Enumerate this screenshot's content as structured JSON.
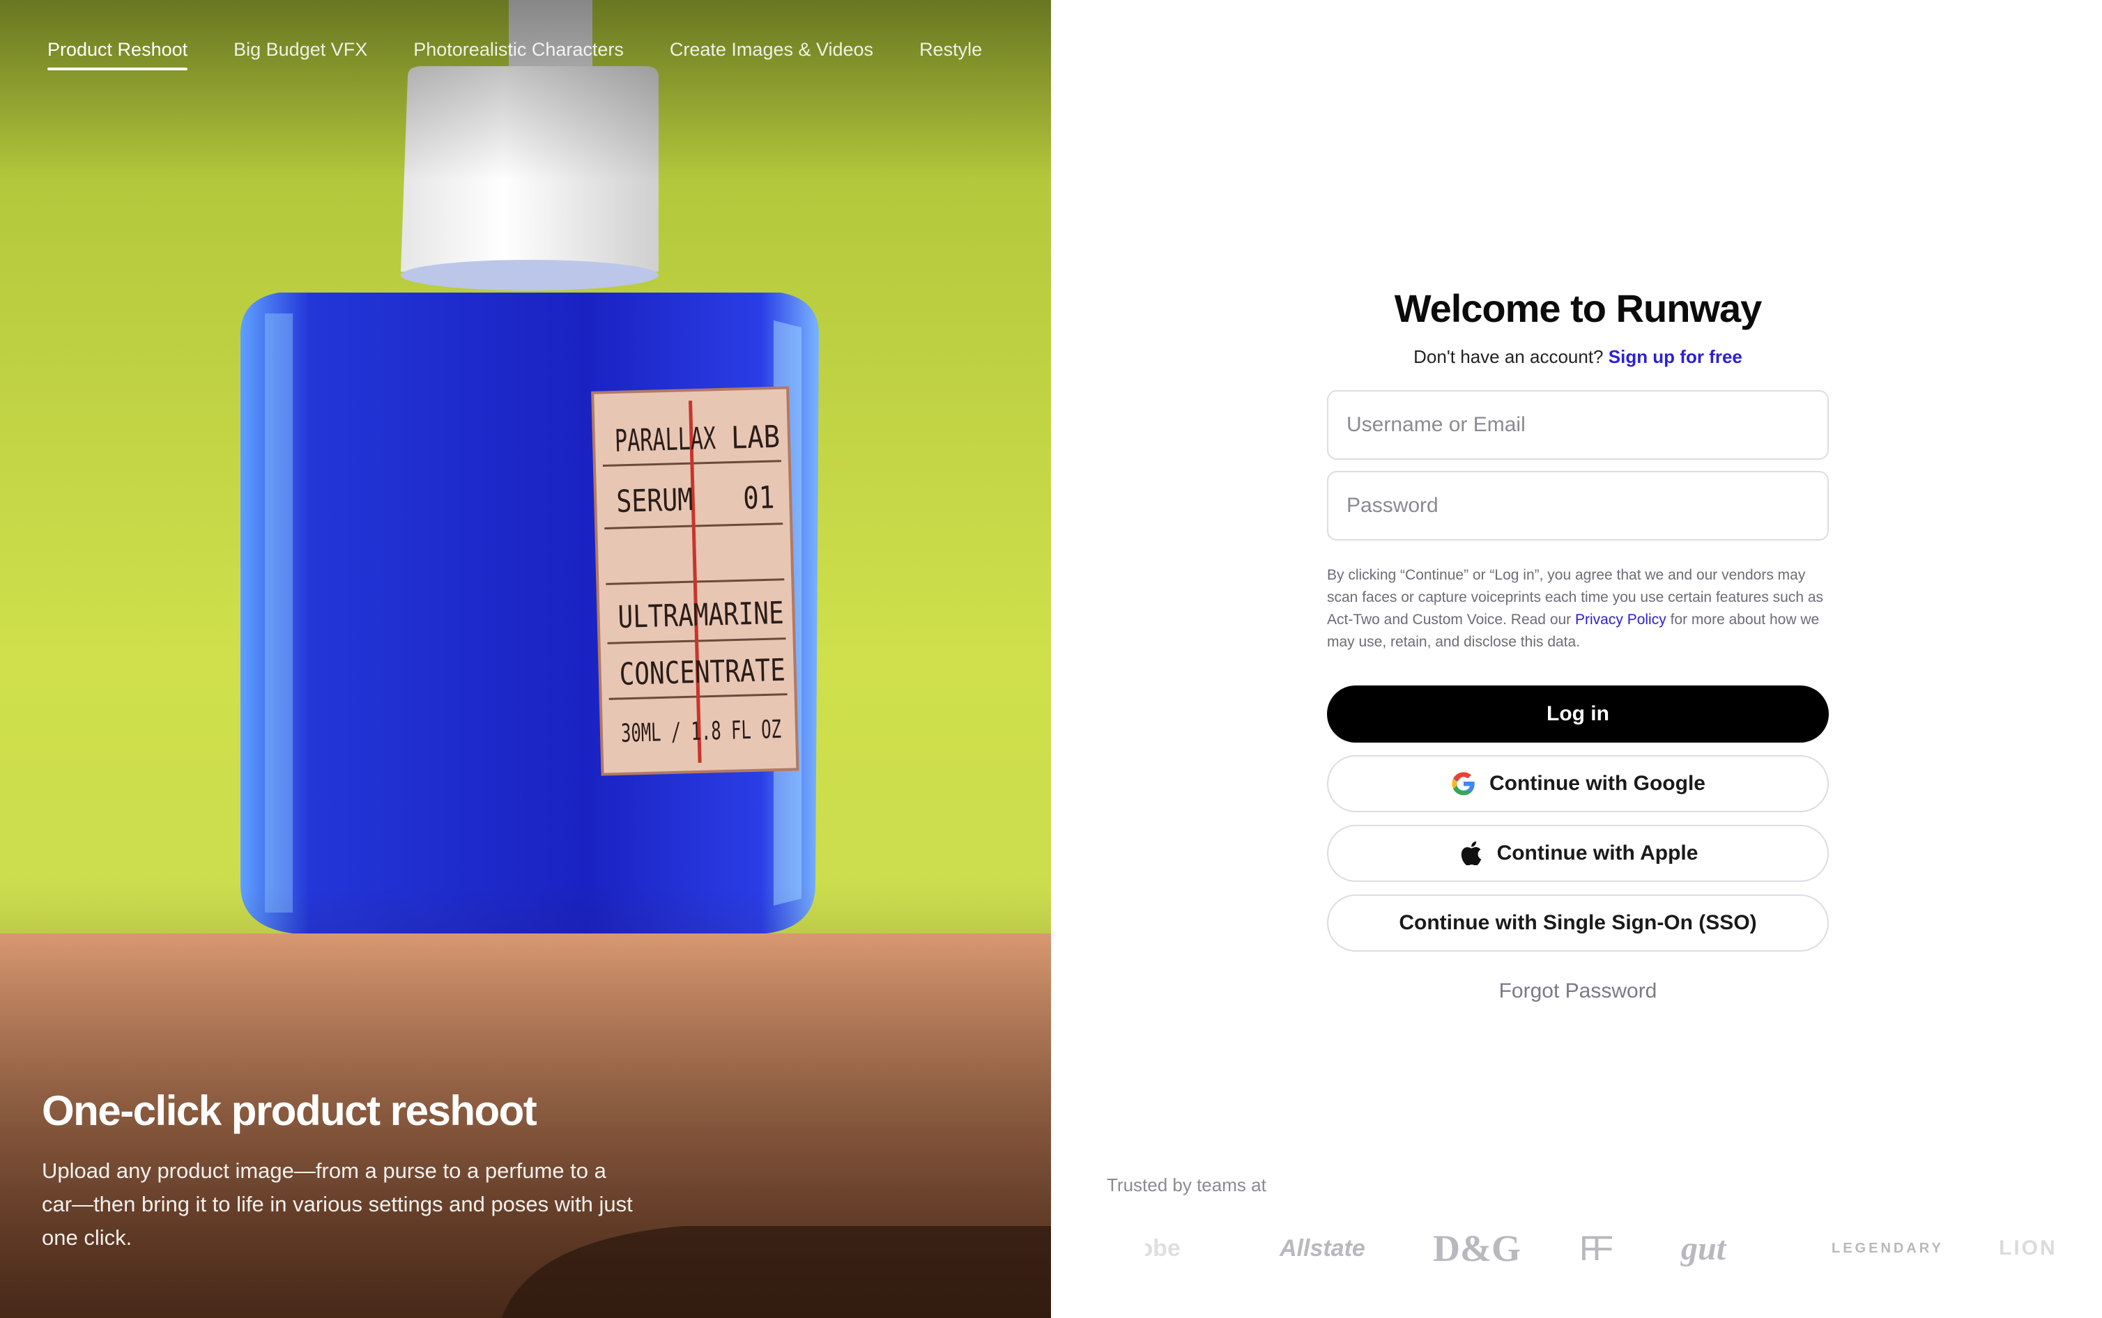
{
  "hero": {
    "tabs": [
      {
        "label": "Product Reshoot",
        "active": true
      },
      {
        "label": "Big Budget VFX",
        "active": false
      },
      {
        "label": "Photorealistic Characters",
        "active": false
      },
      {
        "label": "Create Images & Videos",
        "active": false
      },
      {
        "label": "Restyle",
        "active": false
      }
    ],
    "title": "One-click product reshoot",
    "description": "Upload any product image—from a purse to a perfume to a car—then bring it to life in various settings and poses with just one click.",
    "product_label": {
      "line1a": "PARALLAX",
      "line1b": "LAB",
      "line2a": "SERUM",
      "line2b": "01",
      "line3": "ULTRAMARINE",
      "line4": "CONCENTRATE",
      "line5": "30ML / 1.8 FL OZ"
    }
  },
  "login": {
    "title": "Welcome to Runway",
    "signup_prompt": "Don't have an account?",
    "signup_link": "Sign up for free",
    "username_placeholder": "Username or Email",
    "password_placeholder": "Password",
    "legal_text": "By clicking “Continue” or “Log in”, you agree that we and our vendors may scan faces or capture voiceprints each time you use certain features such as Act-Two and Custom Voice. Read our",
    "legal_link": "Privacy Policy",
    "legal_tail": "for more about how we may use, retain, and disclose this data.",
    "login_button": "Log in",
    "google_button": "Continue with Google",
    "apple_button": "Continue with Apple",
    "sso_button": "Continue with Single Sign-On (SSO)",
    "forgot_password": "Forgot Password"
  },
  "trusted": {
    "label": "Trusted by teams at",
    "logos": [
      "Adobe",
      "Allstate",
      "D&G",
      "FF",
      "gut",
      "LEGENDARY",
      "LIONSGATE"
    ]
  },
  "colors": {
    "link": "#2c1fd6",
    "primary_button": "#000000",
    "hero_background": "#cfe04a",
    "bottle_blue": "#1f2fd8"
  }
}
